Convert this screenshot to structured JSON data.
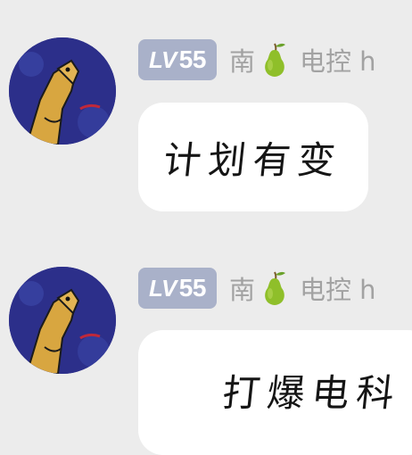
{
  "messages": [
    {
      "level_prefix": "LV",
      "level_number": "55",
      "nickname_before": "南",
      "nickname_icon": "pear-icon",
      "nickname_after": "电控 h",
      "text": "计划有变"
    },
    {
      "level_prefix": "LV",
      "level_number": "55",
      "nickname_before": "南",
      "nickname_icon": "pear-icon",
      "nickname_after": "电控 h",
      "text": "打爆电科"
    }
  ],
  "colors": {
    "background": "#ececec",
    "bubble": "#ffffff",
    "level_badge": "#a9b1c9",
    "nickname": "#a2a2a2",
    "pear": "#8fbf2a"
  }
}
